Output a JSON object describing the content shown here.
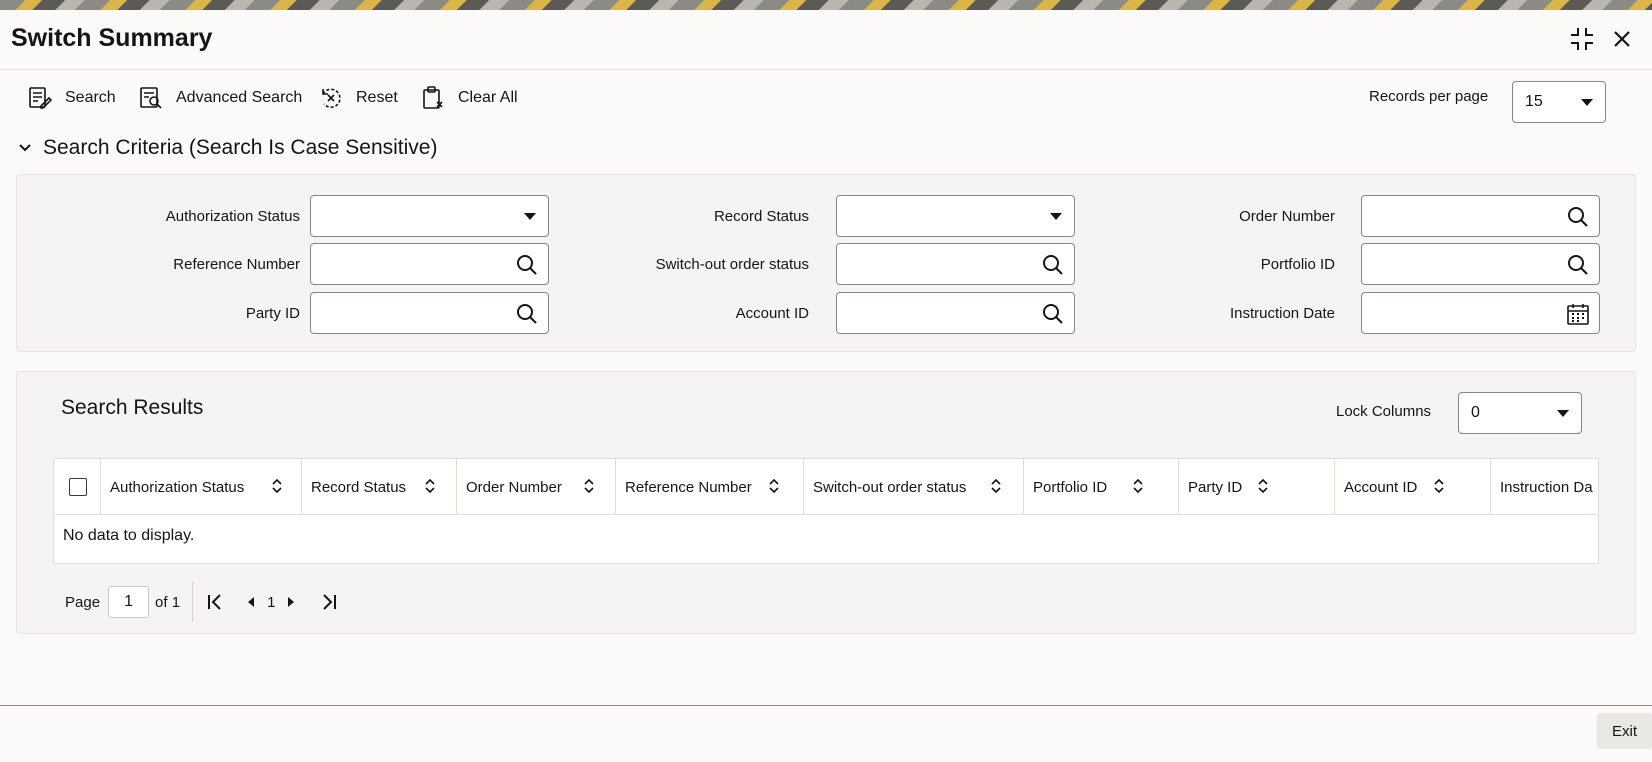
{
  "window": {
    "title": "Switch Summary"
  },
  "toolbar": {
    "search_label": "Search",
    "advanced_search_label": "Advanced Search",
    "reset_label": "Reset",
    "clear_all_label": "Clear All",
    "records_per_page_label": "Records per page",
    "records_per_page_value": "15"
  },
  "criteria": {
    "title": "Search Criteria (Search Is Case Sensitive)",
    "fields": {
      "authorization_status": "Authorization Status",
      "record_status": "Record Status",
      "order_number": "Order Number",
      "reference_number": "Reference Number",
      "switch_out_order_status": "Switch-out order status",
      "portfolio_id": "Portfolio ID",
      "party_id": "Party ID",
      "account_id": "Account ID",
      "instruction_date": "Instruction Date"
    }
  },
  "results": {
    "title": "Search Results",
    "lock_columns_label": "Lock Columns",
    "lock_columns_value": "0",
    "columns": [
      "Authorization Status",
      "Record Status",
      "Order Number",
      "Reference Number",
      "Switch-out order status",
      "Portfolio ID",
      "Party ID",
      "Account ID",
      "Instruction Da"
    ],
    "empty_message": "No data to display."
  },
  "pagination": {
    "page_label": "Page",
    "page_value": "1",
    "of_label": "of 1",
    "current_page": "1"
  },
  "footer": {
    "exit_label": "Exit"
  }
}
